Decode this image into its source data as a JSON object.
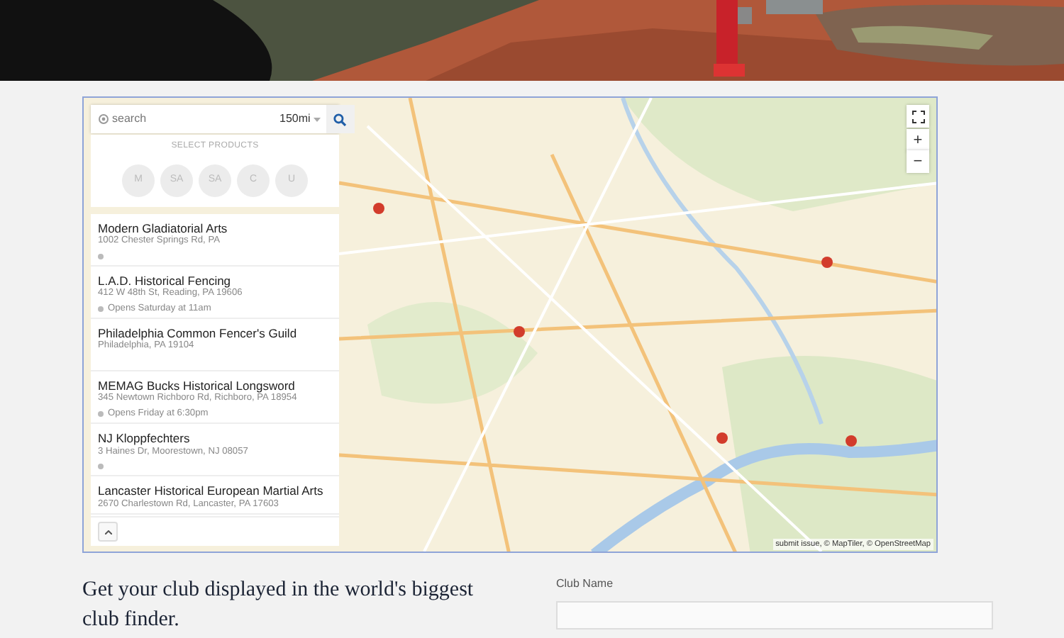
{
  "search": {
    "placeholder": "search",
    "distance": "150mi"
  },
  "products": {
    "heading": "SELECT PRODUCTS",
    "items": [
      {
        "label": "M",
        "selected": false
      },
      {
        "label": "SA",
        "selected": false
      },
      {
        "label": "SA",
        "selected": false
      },
      {
        "label": "C",
        "selected": false
      },
      {
        "label": "U",
        "selected": false
      }
    ]
  },
  "clubs": [
    {
      "name": "Modern Gladiatorial Arts",
      "address": "1002 Chester Springs Rd, PA",
      "status_dot": true
    },
    {
      "name": "L.A.D. Historical Fencing",
      "address": "412 W 48th St, Reading, PA 19606",
      "status_dot": true,
      "hours": "Opens Saturday at 11am"
    },
    {
      "name": "Philadelphia Common Fencer's Guild",
      "address": "Philadelphia, PA 19104",
      "status_dot": false
    },
    {
      "name": "MEMAG Bucks Historical Longsword",
      "address": "345 Newtown Richboro Rd, Richboro, PA 18954",
      "status_dot": true,
      "hours": "Opens Friday at 6:30pm"
    },
    {
      "name": "NJ Kloppfechters",
      "address": "3 Haines Dr, Moorestown, NJ 08057",
      "status_dot": true
    },
    {
      "name": "Lancaster Historical European Martial Arts",
      "address": "2670 Charlestown Rd, Lancaster, PA 17603"
    }
  ],
  "map_controls": {
    "zoom_in": "+",
    "zoom_out": "−"
  },
  "attribution": "submit issue, © MapTiler, © OpenStreetMap",
  "signup": {
    "heading": "Get your club displayed in the world's biggest club finder.",
    "field_label": "Club Name"
  }
}
